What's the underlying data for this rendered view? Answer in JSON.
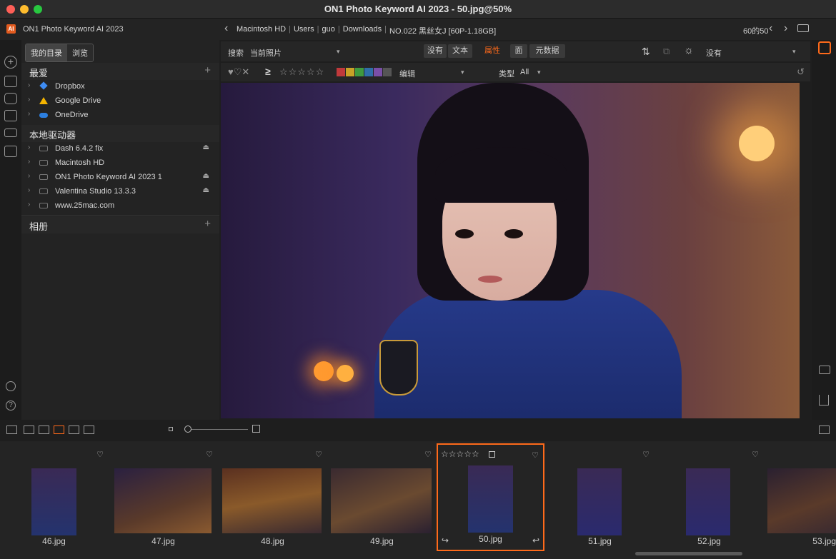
{
  "window": {
    "title": "ON1 Photo Keyword AI 2023 - 50.jpg@50%"
  },
  "app": {
    "name": "ON1 Photo Keyword AI 2023",
    "logo_text": "AI",
    "breadcrumb": [
      "Macintosh HD",
      "Users",
      "guo",
      "Downloads",
      "NO.022 黑丝女J [60P-1.18GB]"
    ],
    "counter": "60的50"
  },
  "left_panel": {
    "tabs": [
      "我的目录",
      "浏览"
    ],
    "favorites": {
      "title": "最爱",
      "items": [
        {
          "label": "Dropbox",
          "icon": "dropbox-icon"
        },
        {
          "label": "Google Drive",
          "icon": "google-drive-icon"
        },
        {
          "label": "OneDrive",
          "icon": "onedrive-icon"
        }
      ]
    },
    "local_drives": {
      "title": "本地驱动器",
      "items": [
        {
          "label": "Dash 6.4.2 fix",
          "eject": true
        },
        {
          "label": "Macintosh HD",
          "eject": false
        },
        {
          "label": "ON1 Photo Keyword AI 2023 1",
          "eject": true
        },
        {
          "label": "Valentina Studio 13.3.3",
          "eject": true
        },
        {
          "label": "www.25mac.com",
          "eject": false
        }
      ]
    },
    "albums": {
      "title": "相册"
    }
  },
  "toolbar": {
    "search_label": "搜索",
    "search_scope": "当前照片",
    "btn_none": "没有",
    "btn_text": "文本",
    "btn_attributes": "属性",
    "btn_face": "面",
    "btn_metadata": "元数据",
    "right_dropdown": "没有",
    "edit_label": "编辑",
    "type_label": "类型",
    "type_value": "All",
    "gte_symbol": "≥",
    "stars": "☆☆☆☆☆",
    "hearts": "♥♡✕"
  },
  "color_labels": [
    "#c0393b",
    "#c9a227",
    "#3f9a3f",
    "#2f6fa8",
    "#7a4fa8",
    "#555555"
  ],
  "accent_color": "#ff6a1a",
  "filmstrip": {
    "items": [
      {
        "name": "46.jpg",
        "selected": false
      },
      {
        "name": "47.jpg",
        "selected": false
      },
      {
        "name": "48.jpg",
        "selected": false
      },
      {
        "name": "49.jpg",
        "selected": false
      },
      {
        "name": "50.jpg",
        "selected": true,
        "stars": "☆☆☆☆☆"
      },
      {
        "name": "51.jpg",
        "selected": false
      },
      {
        "name": "52.jpg",
        "selected": false
      },
      {
        "name": "53.jpg",
        "selected": false
      }
    ]
  }
}
